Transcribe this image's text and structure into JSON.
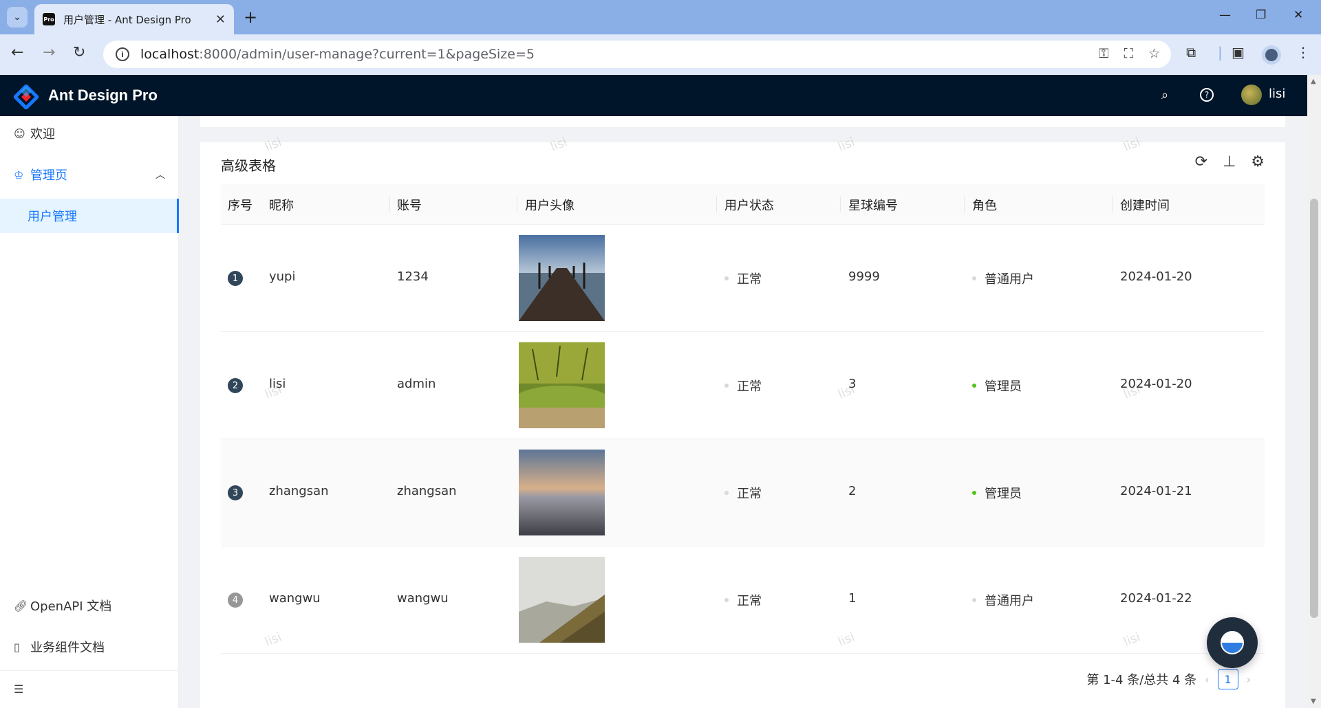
{
  "browser": {
    "tab_title": "用户管理 - Ant Design Pro",
    "favicon_text": "Pro",
    "url_host": "localhost",
    "url_rest": ":8000/admin/user-manage?current=1&pageSize=5"
  },
  "app": {
    "title": "Ant Design Pro",
    "username": "lisi"
  },
  "sidebar": {
    "items": [
      {
        "label": "欢迎",
        "icon": "smile-icon"
      },
      {
        "label": "管理页",
        "icon": "crown-icon"
      },
      {
        "label": "用户管理"
      },
      {
        "label": "OpenAPI 文档",
        "icon": "link-icon"
      },
      {
        "label": "业务组件文档",
        "icon": "book-icon"
      }
    ]
  },
  "table": {
    "title": "高级表格",
    "headers": [
      "序号",
      "昵称",
      "账号",
      "用户头像",
      "用户状态",
      "星球编号",
      "角色",
      "创建时间"
    ],
    "rows": [
      {
        "index": "1",
        "nickname": "yupi",
        "account": "1234",
        "status": "正常",
        "planet": "9999",
        "role": "普通用户",
        "created": "2024-01-20"
      },
      {
        "index": "2",
        "nickname": "lisi",
        "account": "admin",
        "status": "正常",
        "planet": "3",
        "role": "管理员",
        "created": "2024-01-20"
      },
      {
        "index": "3",
        "nickname": "zhangsan",
        "account": "zhangsan",
        "status": "正常",
        "planet": "2",
        "role": "管理员",
        "created": "2024-01-21"
      },
      {
        "index": "4",
        "nickname": "wangwu",
        "account": "wangwu",
        "status": "正常",
        "planet": "1",
        "role": "普通用户",
        "created": "2024-01-22"
      }
    ]
  },
  "pagination": {
    "summary": "第 1-4 条/总共 4 条",
    "current": "1"
  },
  "watermark_text": "lisi",
  "colors": {
    "header_bg": "#001529",
    "primary": "#1677ff",
    "admin_dot": "#52c41a",
    "user_dot": "#d9d9d9"
  }
}
